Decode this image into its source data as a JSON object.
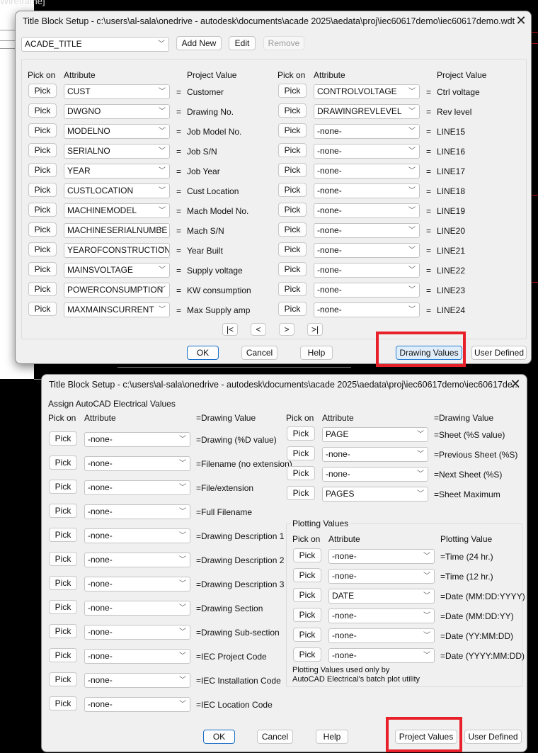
{
  "background": {
    "cad_label": "Wireframe]"
  },
  "dialog1": {
    "title": "Title Block Setup - c:\\users\\al-sala\\onedrive - autodesk\\documents\\acade 2025\\aedata\\proj\\iec60617demo\\iec60617demo.wdt",
    "close": "✕",
    "block_select": "ACADE_TITLE",
    "add_new": "Add New",
    "edit": "Edit",
    "remove": "Remove",
    "headers": {
      "pick_on": "Pick on",
      "attribute": "Attribute",
      "project_value": "Project Value"
    },
    "pick_label": "Pick",
    "equals": "=",
    "left_rows": [
      {
        "attr": "CUST",
        "value": "Customer"
      },
      {
        "attr": "DWGNO",
        "value": "Drawing No."
      },
      {
        "attr": "MODELNO",
        "value": "Job Model No."
      },
      {
        "attr": "SERIALNO",
        "value": "Job S/N"
      },
      {
        "attr": "YEAR",
        "value": "Job Year"
      },
      {
        "attr": "CUSTLOCATION",
        "value": "Cust Location"
      },
      {
        "attr": "MACHINEMODEL",
        "value": "Mach Model No."
      },
      {
        "attr": "MACHINESERIALNUMBE",
        "value": "Mach S/N"
      },
      {
        "attr": "YEAROFCONSTRUCTION",
        "value": "Year Built"
      },
      {
        "attr": "MAINSVOLTAGE",
        "value": "Supply voltage"
      },
      {
        "attr": "POWERCONSUMPTION",
        "value": "KW consumption"
      },
      {
        "attr": "MAXMAINSCURRENT",
        "value": "Max Supply amp"
      }
    ],
    "right_rows": [
      {
        "attr": "CONTROLVOLTAGE",
        "value": "Ctrl voltage"
      },
      {
        "attr": "DRAWINGREVLEVEL",
        "value": "Rev level"
      },
      {
        "attr": "-none-",
        "value": "LINE15"
      },
      {
        "attr": "-none-",
        "value": "LINE16"
      },
      {
        "attr": "-none-",
        "value": "LINE17"
      },
      {
        "attr": "-none-",
        "value": "LINE18"
      },
      {
        "attr": "-none-",
        "value": "LINE19"
      },
      {
        "attr": "-none-",
        "value": "LINE20"
      },
      {
        "attr": "-none-",
        "value": "LINE21"
      },
      {
        "attr": "-none-",
        "value": "LINE22"
      },
      {
        "attr": "-none-",
        "value": "LINE23"
      },
      {
        "attr": "-none-",
        "value": "LINE24"
      }
    ],
    "nav": {
      "first": "|<",
      "prev": "<",
      "next": ">",
      "last": ">|"
    },
    "ok": "OK",
    "cancel": "Cancel",
    "help": "Help",
    "drawing_values": "Drawing Values",
    "user_defined": "User Defined"
  },
  "dialog2": {
    "title": "Title Block Setup - c:\\users\\al-sala\\onedrive - autodesk\\documents\\acade 2025\\aedata\\proj\\iec60617demo\\iec60617de...",
    "close": "✕",
    "section": "Assign AutoCAD Electrical Values",
    "headers": {
      "pick_on": "Pick on",
      "attribute": "Attribute",
      "drawing_value": "=Drawing Value",
      "plotting_value": "Plotting Value"
    },
    "pick_label": "Pick",
    "left_rows": [
      {
        "attr": "-none-",
        "value": "=Drawing (%D value)"
      },
      {
        "attr": "-none-",
        "value": "=Filename (no extension)"
      },
      {
        "attr": "-none-",
        "value": "=File/extension"
      },
      {
        "attr": "-none-",
        "value": "=Full Filename"
      },
      {
        "attr": "-none-",
        "value": "=Drawing Description 1"
      },
      {
        "attr": "-none-",
        "value": "=Drawing Description 2"
      },
      {
        "attr": "-none-",
        "value": "=Drawing Description 3"
      },
      {
        "attr": "-none-",
        "value": "=Drawing Section"
      },
      {
        "attr": "-none-",
        "value": "=Drawing Sub-section"
      },
      {
        "attr": "-none-",
        "value": "=IEC Project Code"
      },
      {
        "attr": "-none-",
        "value": "=IEC Installation Code"
      },
      {
        "attr": "-none-",
        "value": "=IEC Location Code"
      }
    ],
    "right_rows": [
      {
        "attr": "PAGE",
        "value": "=Sheet (%S value)"
      },
      {
        "attr": "-none-",
        "value": "=Previous Sheet (%S)"
      },
      {
        "attr": "-none-",
        "value": "=Next Sheet (%S)"
      },
      {
        "attr": "PAGES",
        "value": "=Sheet Maximum"
      }
    ],
    "plotting": {
      "group_label": "Plotting Values",
      "rows": [
        {
          "attr": "-none-",
          "value": "=Time (24 hr.)"
        },
        {
          "attr": "-none-",
          "value": "=Time (12 hr.)"
        },
        {
          "attr": "DATE",
          "value": "=Date (MM:DD:YYYY)"
        },
        {
          "attr": "-none-",
          "value": "=Date (MM:DD:YY)"
        },
        {
          "attr": "-none-",
          "value": "=Date (YY:MM:DD)"
        },
        {
          "attr": "-none-",
          "value": "=Date (YYYY:MM:DD)"
        }
      ],
      "note_line1": "Plotting Values used only by",
      "note_line2": "AutoCAD Electrical's batch plot utility"
    },
    "ok": "OK",
    "cancel": "Cancel",
    "help": "Help",
    "project_values": "Project Values",
    "user_defined": "User Defined"
  }
}
